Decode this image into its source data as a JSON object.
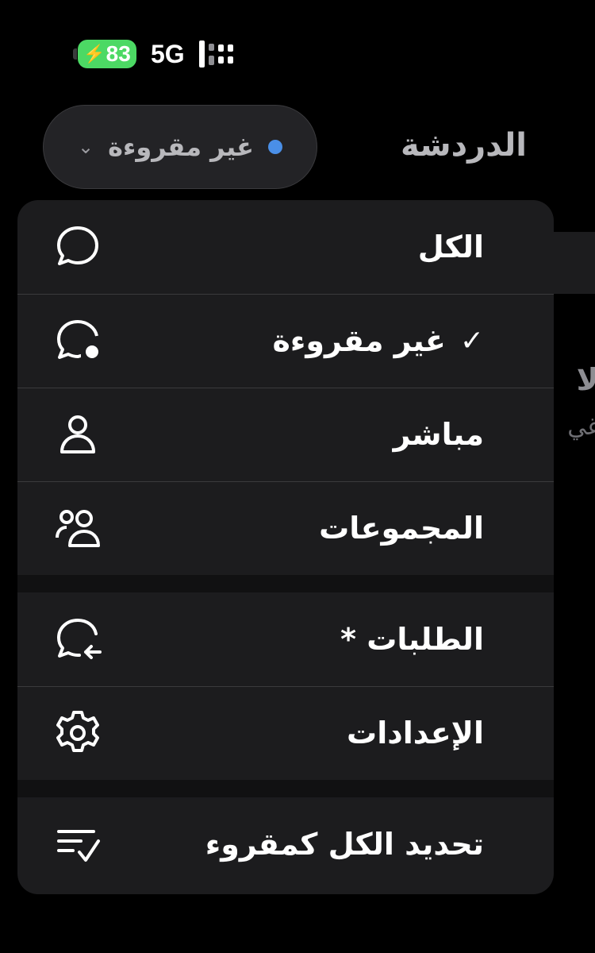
{
  "status_bar": {
    "battery": "83",
    "network": "5G"
  },
  "header": {
    "title": "الدردشة",
    "filter": {
      "label": "غير مقروءة",
      "indicator_color": "#4a8fe7"
    }
  },
  "background_peek": {
    "line1": "الا",
    "line2": "غي"
  },
  "menu": {
    "groups": [
      [
        {
          "label": "الكل",
          "icon": "chat-bubble-icon",
          "checked": false
        },
        {
          "label": "غير مقروءة",
          "icon": "chat-unread-icon",
          "checked": true
        },
        {
          "label": "مباشر",
          "icon": "person-icon",
          "checked": false
        },
        {
          "label": "المجموعات",
          "icon": "people-icon",
          "checked": false
        }
      ],
      [
        {
          "label": "الطلبات *",
          "icon": "chat-request-icon",
          "checked": false
        },
        {
          "label": "الإعدادات",
          "icon": "gear-icon",
          "checked": false
        }
      ],
      [
        {
          "label": "تحديد الكل كمقروء",
          "icon": "mark-all-read-icon",
          "checked": false
        }
      ]
    ],
    "check_mark": "✓"
  }
}
